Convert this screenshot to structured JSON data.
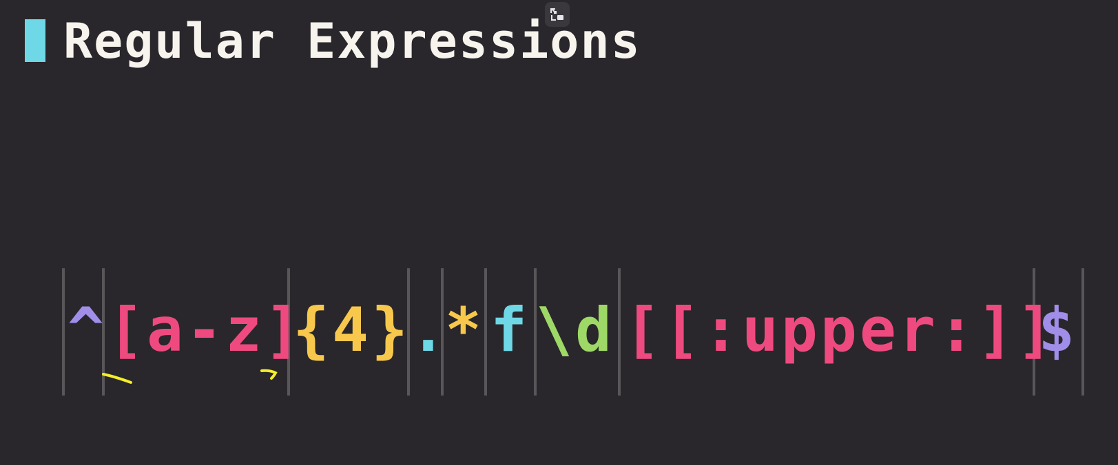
{
  "header": {
    "title": "Regular Expressions",
    "accent_color": "#6fd8e6",
    "exit_fullscreen_icon": "exit-fullscreen-icon"
  },
  "regex": {
    "tokens": [
      {
        "text": "^",
        "color": "#a08ee8",
        "name": "token-caret"
      },
      {
        "text": "[a-z]",
        "color": "#ee4a7f",
        "name": "token-char-class"
      },
      {
        "text": "{4}",
        "color": "#f7c84b",
        "name": "token-quantifier"
      },
      {
        "text": ".",
        "color": "#6fd8e6",
        "name": "token-dot"
      },
      {
        "text": "*",
        "color": "#f7c84b",
        "name": "token-star"
      },
      {
        "text": "f",
        "color": "#6fd8e6",
        "name": "token-literal-f"
      },
      {
        "text": "\\d",
        "color": "#9ed867",
        "name": "token-digit"
      },
      {
        "text": "[[:upper:]]",
        "color": "#ee4a7f",
        "name": "token-posix-class"
      },
      {
        "text": "$",
        "color": "#a08ee8",
        "name": "token-dollar"
      }
    ],
    "separator_color": "#59565a",
    "annotation_color": "#f4ef2a"
  }
}
